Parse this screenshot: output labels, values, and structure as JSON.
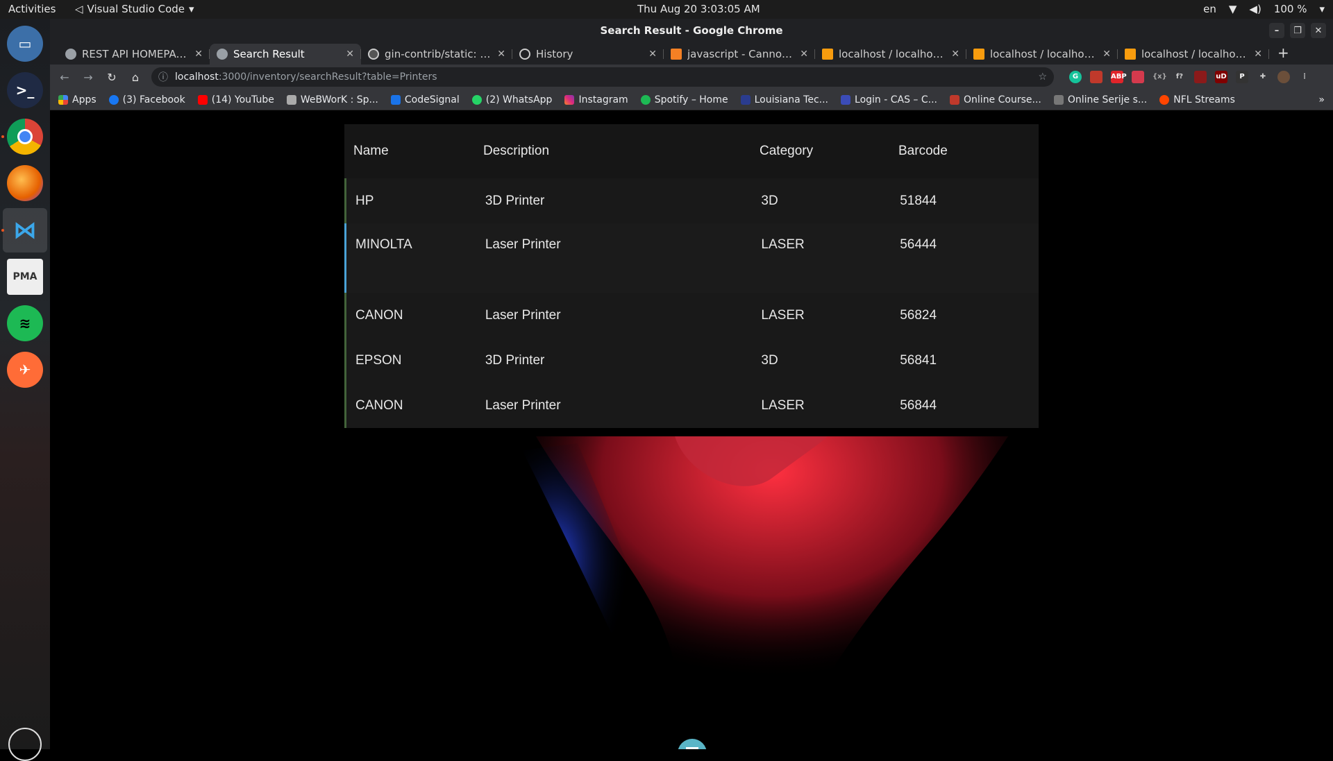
{
  "topbar": {
    "activities": "Activities",
    "app_name": "Visual Studio Code",
    "clock": "Thu Aug 20  3:03:05 AM",
    "lang": "en",
    "battery": "100 %"
  },
  "window": {
    "title": "Search Result - Google Chrome"
  },
  "tabs": [
    {
      "label": "REST API HOMEPAGE",
      "icon": "globe-icon"
    },
    {
      "label": "Search Result",
      "icon": "globe-icon"
    },
    {
      "label": "gin-contrib/static: Stat",
      "icon": "github-icon"
    },
    {
      "label": "History",
      "icon": "history-icon"
    },
    {
      "label": "javascript - Cannot rea",
      "icon": "stackoverflow-icon"
    },
    {
      "label": "localhost / localhost / ",
      "icon": "phpmyadmin-icon"
    },
    {
      "label": "localhost / localhost / ",
      "icon": "phpmyadmin-icon"
    },
    {
      "label": "localhost / localhost / ",
      "icon": "phpmyadmin-icon"
    }
  ],
  "address": {
    "host": "localhost",
    "path": ":3000/inventory/searchResult?table=Printers"
  },
  "bookmarks": [
    "Apps",
    "(3) Facebook",
    "(14) YouTube",
    "WeBWorK : Sp...",
    "CodeSignal",
    "(2) WhatsApp",
    "Instagram",
    "Spotify – Home",
    "Louisiana Tec...",
    "Login - CAS – C...",
    "Online Course...",
    "Online Serije s...",
    "NFL Streams"
  ],
  "table": {
    "headers": [
      "Name",
      "Description",
      "Category",
      "Barcode"
    ],
    "rows": [
      [
        "HP",
        "3D Printer",
        "3D",
        "51844"
      ],
      [
        "MINOLTA",
        "Laser Printer",
        "LASER",
        "56444"
      ],
      [
        "CANON",
        "Laser Printer",
        "LASER",
        "56824"
      ],
      [
        "EPSON",
        "3D Printer",
        "3D",
        "56841"
      ],
      [
        "CANON",
        "Laser Printer",
        "LASER",
        "56844"
      ]
    ]
  },
  "colors": {
    "accent": "#4aa3d8",
    "row_border": "#43633a",
    "table_bg": "#1d1d1d"
  }
}
